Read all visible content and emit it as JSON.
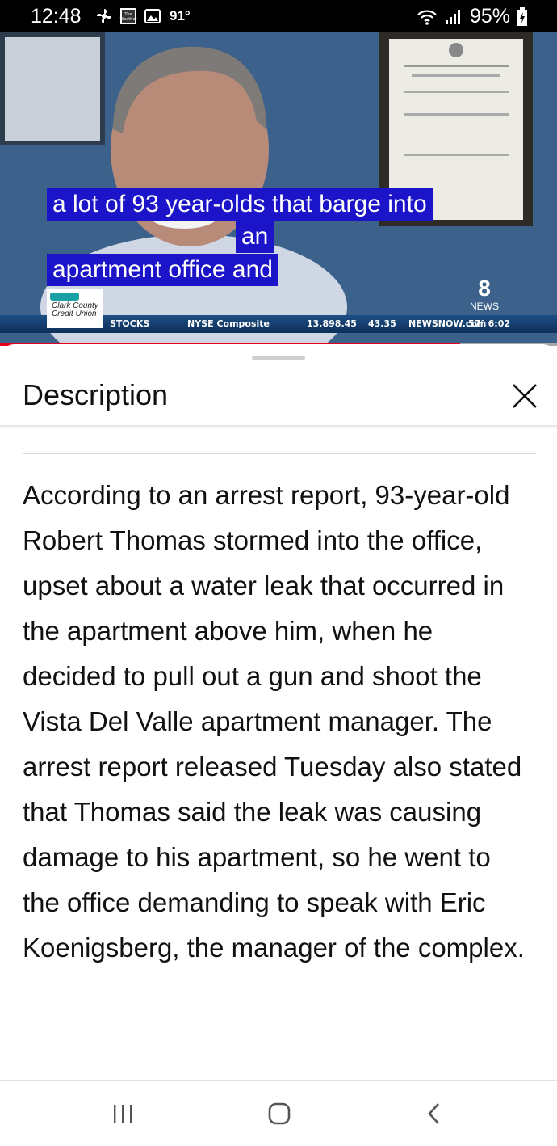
{
  "status_bar": {
    "time": "12:48",
    "icons": [
      "fan-icon",
      "weather-channel-icon",
      "gallery-icon",
      "wifi-icon",
      "signal-icon",
      "battery-charging-icon"
    ],
    "weather_badge_text": "The Weather Channel",
    "temperature": "91°",
    "battery": "95%"
  },
  "video": {
    "captions": [
      "a lot of 93 year-olds that barge into",
      "an",
      "apartment office and"
    ],
    "caption_bg_color": "#1c14c8",
    "ticker": {
      "sponsor": [
        "Clark County",
        "Credit Union"
      ],
      "label": "STOCKS",
      "index_name": "NYSE Composite",
      "index_value": "13,898.45",
      "change": "43.35",
      "site": "NEWSNOW.com",
      "temp_time": "57° 6:02"
    },
    "channel_badge": {
      "number": "8",
      "label": "NEWS"
    },
    "progress_fraction": 0.826,
    "progress_color": "#e8001c"
  },
  "sheet": {
    "title": "Description",
    "description": "According to an arrest report, 93-year-old Robert Thomas stormed into the office, upset about a water leak that occurred in the apartment above him, when he decided to pull out a gun and shoot the Vista Del Valle apartment manager.  The arrest report released Tuesday also stated that Thomas said the leak was causing damage to his apartment, so he went to the office demanding to speak with Eric Koenigsberg, the manager of the complex."
  },
  "nav_bar": {
    "buttons": [
      "recent-apps-icon",
      "home-icon",
      "back-icon"
    ]
  }
}
